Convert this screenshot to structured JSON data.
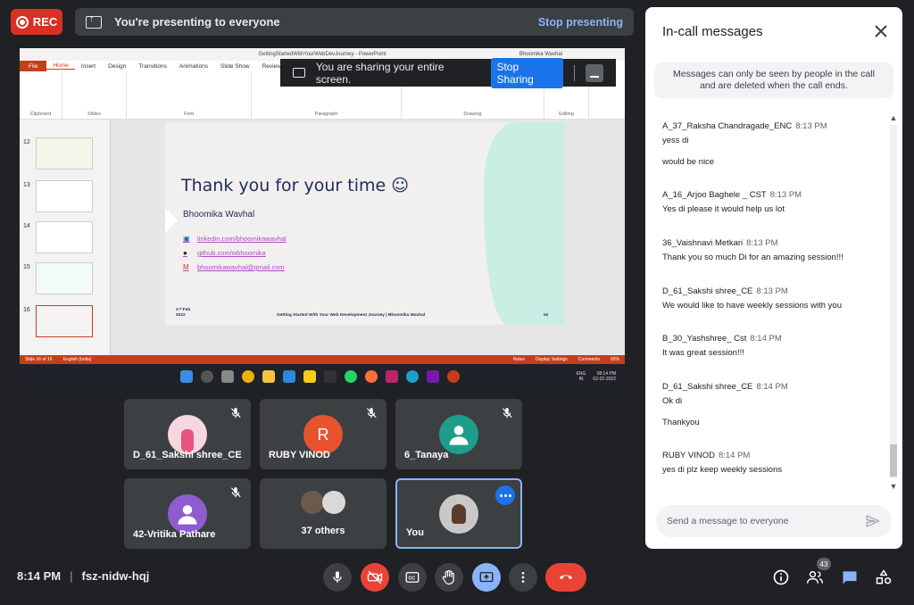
{
  "topbar": {
    "rec_label": "REC",
    "presenting_text": "You're presenting to everyone",
    "stop_presenting_label": "Stop presenting"
  },
  "shared_screen": {
    "window_title": "GettingStartedWithYourWebDevJourney - PowerPoint",
    "window_user": "Bhoomika Wavhal",
    "ribbon_tabs": [
      "File",
      "Home",
      "Insert",
      "Design",
      "Transitions",
      "Animations",
      "Slide Show",
      "Review"
    ],
    "ribbon_groups": [
      "Clipboard",
      "Slides",
      "Font",
      "Paragraph",
      "Drawing",
      "Editing"
    ],
    "share_notice": "You are sharing your entire screen.",
    "stop_sharing_label": "Stop Sharing",
    "slide_numbers": [
      "12",
      "13",
      "14",
      "15",
      "16"
    ],
    "slide": {
      "headline": "Thank you for your time ☺",
      "author": "Bhoomika Wavhal",
      "links": [
        "linkedin.com/bhoomikawavhal",
        "github.com/wbhoomika",
        "bhoomikawavhal@gmail.com"
      ],
      "footer_date_line1": "2ⁿᵈ Feb",
      "footer_date_line2": "2022",
      "footer_title": "Getting Started With Your Web Development Journey | Bhoomika Wavhal",
      "footer_page": "16"
    },
    "status_left": "Slide 16 of 16",
    "status_lang": "English (India)",
    "status_notes": "Notes",
    "status_display": "Display Settings",
    "status_comments": "Comments",
    "status_zoom": "65%",
    "tray_lang1": "ENG",
    "tray_lang2": "IN",
    "tray_time": "08:14 PM",
    "tray_date": "02-02-2022"
  },
  "tiles": [
    {
      "name": "D_61_Sakshi shree_CE",
      "muted": true
    },
    {
      "name": "RUBY VINOD",
      "initial": "R",
      "muted": true
    },
    {
      "name": "6_Tanaya",
      "muted": true
    },
    {
      "name": "42-Vritika Pathare",
      "muted": true
    },
    {
      "name": "37 others"
    },
    {
      "name": "You"
    }
  ],
  "chat": {
    "title": "In-call messages",
    "note": "Messages can only be seen by people in the call and are deleted when the call ends.",
    "messages": [
      {
        "sender": "A_37_Raksha Chandragade_ENC",
        "time": "8:13 PM",
        "lines": [
          "yess di",
          "would be nice"
        ]
      },
      {
        "sender": "A_16_Arjoo Baghele _ CST",
        "time": "8:13 PM",
        "lines": [
          "Yes di please it would help us lot"
        ]
      },
      {
        "sender": "36_Vaishnavi Metkari",
        "time": "8:13 PM",
        "lines": [
          "Thank you so much Di for an amazing session!!!"
        ]
      },
      {
        "sender": "D_61_Sakshi shree_CE",
        "time": "8:13 PM",
        "lines": [
          "We would like to have weekly sessions with you"
        ]
      },
      {
        "sender": "B_30_Yashshree_ Cst",
        "time": "8:14 PM",
        "lines": [
          "It was great session!!!"
        ]
      },
      {
        "sender": "D_61_Sakshi shree_CE",
        "time": "8:14 PM",
        "lines": [
          "Ok di",
          "Thankyou"
        ]
      },
      {
        "sender": "RUBY VINOD",
        "time": "8:14 PM",
        "lines": [
          "yes di plz keep weekly sessions"
        ]
      }
    ],
    "input_placeholder": "Send a message to everyone"
  },
  "bottombar": {
    "time": "8:14 PM",
    "separator": "|",
    "meeting_code": "fsz-nidw-hqj",
    "participants_count": "43"
  },
  "colors": {
    "background": "#202124",
    "rec_red": "#d93025",
    "accent_blue": "#8ab4f8",
    "end_call": "#ea4335",
    "ppt_orange": "#c43e1c"
  }
}
